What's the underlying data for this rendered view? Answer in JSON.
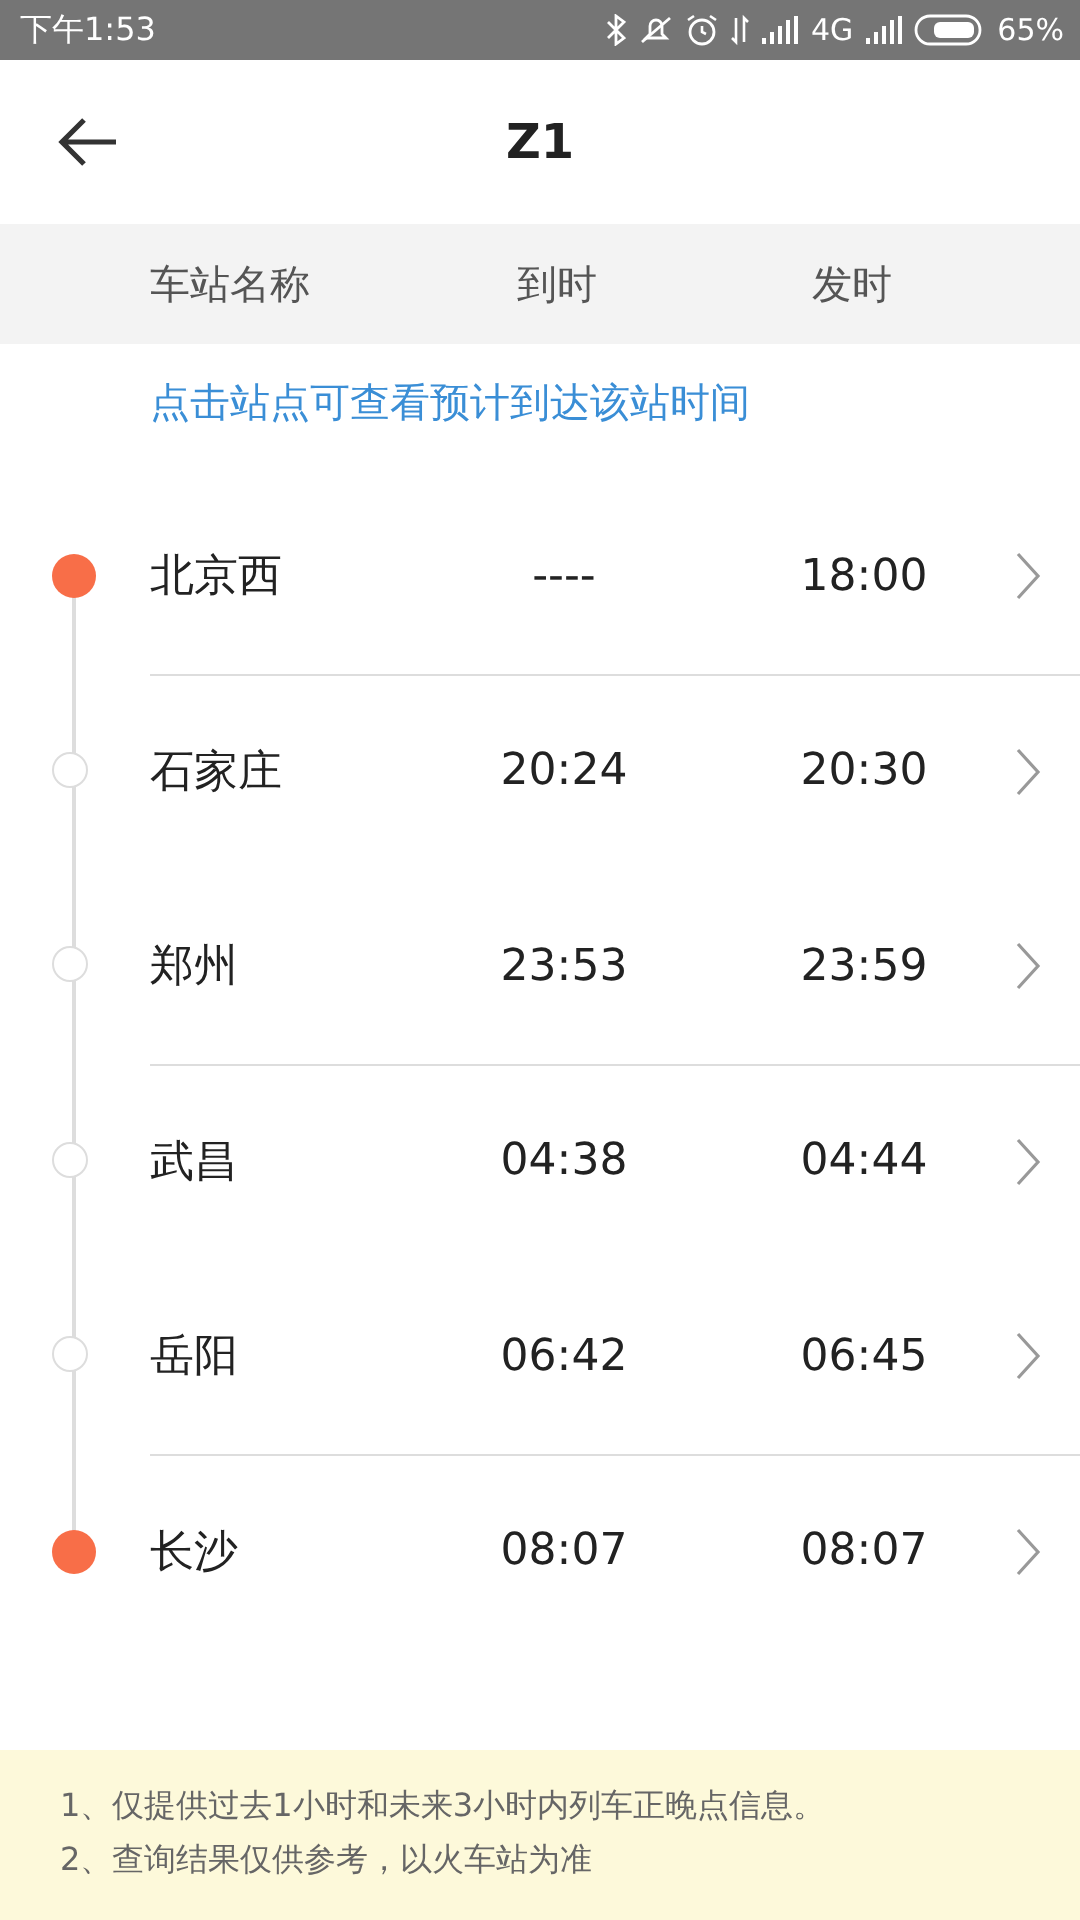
{
  "status_bar": {
    "time": "下午1:53",
    "network": "4G",
    "battery": "65%"
  },
  "header": {
    "title": "Z1"
  },
  "columns": [
    "车站名称",
    "到时",
    "发时"
  ],
  "hint": "点击站点可查看预计到达该站时间",
  "stations": [
    {
      "name": "北京西",
      "arrive": "----",
      "depart": "18:00",
      "highlighted": true,
      "divider": true
    },
    {
      "name": "石家庄",
      "arrive": "20:24",
      "depart": "20:30",
      "highlighted": false,
      "divider": false
    },
    {
      "name": "郑州",
      "arrive": "23:53",
      "depart": "23:59",
      "highlighted": false,
      "divider": true
    },
    {
      "name": "武昌",
      "arrive": "04:38",
      "depart": "04:44",
      "highlighted": false,
      "divider": false
    },
    {
      "name": "岳阳",
      "arrive": "06:42",
      "depart": "06:45",
      "highlighted": false,
      "divider": true
    },
    {
      "name": "长沙",
      "arrive": "08:07",
      "depart": "08:07",
      "highlighted": true,
      "divider": false
    }
  ],
  "notes": [
    "1、仅提供过去1小时和未来3小时内列车正晚点信息。",
    "2、查询结果仅供参考，以火车站为准"
  ]
}
